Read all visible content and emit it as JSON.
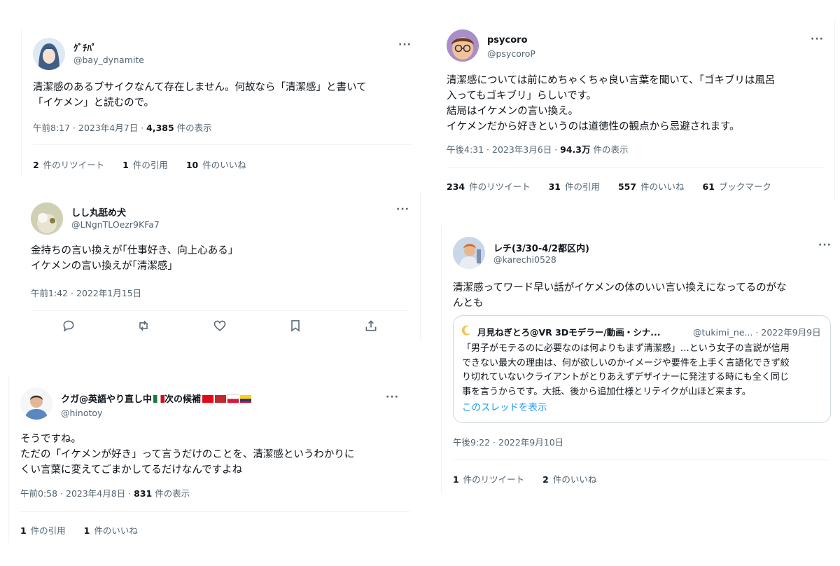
{
  "tweets": {
    "t1": {
      "name": "ｸﾞﾁﾊﾟ",
      "handle": "@bay_dynamite",
      "text": "清潔感のあるブサイクなんて存在しません。何故なら「清潔感」と書いて\n「イケメン」と読むので。",
      "time": "午前8:17 · 2023年4月7日 · ",
      "views_num": "4,385",
      "views_label": " 件の表示",
      "retweets": {
        "num": "2",
        "label": " 件のリツイート"
      },
      "quotes": {
        "num": "1",
        "label": " 件の引用"
      },
      "likes": {
        "num": "10",
        "label": " 件のいいね"
      }
    },
    "t2": {
      "name": "しし丸舐め犬",
      "handle": "@LNgnTLOezr9KFa7",
      "text": "金持ちの言い換えが｢仕事好き、向上心ある｣\nイケメンの言い換えが｢清潔感｣",
      "time": "午前1:42 · 2022年1月15日"
    },
    "t3": {
      "name": "クガ@英語やり直し中",
      "name_suffix": "次の候補",
      "handle": "@hinotoy",
      "text": "そうですね。\nただの「イケメンが好き」って言うだけのことを、清潔感というわかりに\nくい言葉に変えてごまかしてるだけなんですよね",
      "time": "午前0:58 · 2023年4月8日 · ",
      "views_num": "831",
      "views_label": " 件の表示",
      "quotes": {
        "num": "1",
        "label": " 件の引用"
      },
      "likes": {
        "num": "1",
        "label": " 件のいいね"
      }
    },
    "t4": {
      "name": "psycoro",
      "handle": "@psycoroP",
      "text": "清潔感については前にめちゃくちゃ良い言葉を聞いて、「ゴキブリは風呂\n入ってもゴキブリ」らしいです。\n結局はイケメンの言い換え。\nイケメンだから好きというのは道徳性の観点から忌避されます。",
      "time": "午後4:31 · 2023年3月6日 · ",
      "views_num": "94.3万",
      "views_label": " 件の表示",
      "retweets": {
        "num": "234",
        "label": " 件のリツイート"
      },
      "quotes": {
        "num": "31",
        "label": " 件の引用"
      },
      "likes": {
        "num": "557",
        "label": " 件のいいね"
      },
      "bookmarks": {
        "num": "61",
        "label": " ブックマーク"
      }
    },
    "t5": {
      "name": "レチ(3/30-4/2都区内)",
      "handle": "@karechi0528",
      "text": "清潔感ってワード早い話がイケメンの体のいい言い換えになってるのがな\nんとも",
      "time": "午後9:22 · 2022年9月10日",
      "retweets": {
        "num": "1",
        "label": " 件のリツイート"
      },
      "likes": {
        "num": "2",
        "label": " 件のいいね"
      },
      "quote": {
        "name": "月見ねぎとろ@VR 3Dモデラー/動画・シナ...",
        "handle_date": "@tukimi_ne... · 2022年9月9日",
        "text": "「男子がモテるのに必要なのは何よりもまず清潔感」…という女子の言説が信用\nできない最大の理由は、何が欲しいのかイメージや要件を上手く言語化できず絞\nり切れていないクライアントがとりあえずデザイナーに発注する時にも全く同じ\n事を言うからです。大抵、後から追加仕様とリテイクが山ほど来ます。",
        "show_thread": "このスレッドを表示"
      }
    }
  },
  "more_glyph": "···",
  "colors": {
    "link": "#1d9bf0",
    "muted": "#536471",
    "border": "#eff3f4"
  }
}
